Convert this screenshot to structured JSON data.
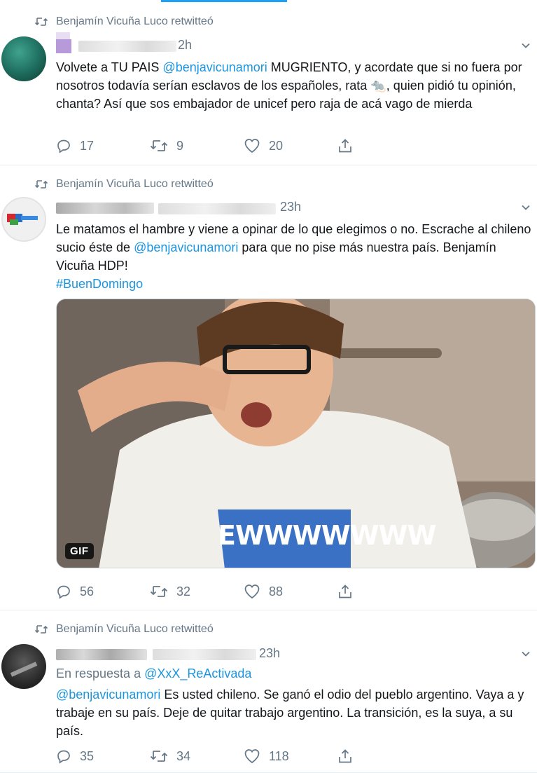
{
  "tweets": [
    {
      "retweeted_by": "Benjamín Vicuña Luco retwitteó",
      "time": "2h",
      "text_parts": {
        "a": "Volvete a TU PAIS ",
        "mention": "@benjavicunamori",
        "b": " MUGRIENTO, y acordate que si no fuera por nosotros todavía serían esclavos de los españoles, rata ",
        "emoji": "🐀",
        "c": ", quien pidió tu opinión, chanta? Así que sos embajador de unicef pero raja de acá vago de mierda"
      },
      "replies": "17",
      "retweets": "9",
      "likes": "20"
    },
    {
      "retweeted_by": "Benjamín Vicuña Luco retwitteó",
      "time": "23h",
      "text_parts": {
        "a": "Le matamos el hambre y viene a opinar de lo que elegimos o no. Escrache al chileno sucio éste de ",
        "mention": "@benjavicunamori",
        "b": " para que no pise más nuestra país. Benjamín Vicuña HDP!",
        "hashtag": "#BuenDomingo"
      },
      "media": {
        "badge": "GIF",
        "caption": "EWWWWWWW"
      },
      "replies": "56",
      "retweets": "32",
      "likes": "88"
    },
    {
      "retweeted_by": "Benjamín Vicuña Luco retwitteó",
      "time": "23h",
      "reply_prefix": "En respuesta a ",
      "reply_to": "@XxX_ReActivada",
      "text_parts": {
        "mention": "@benjavicunamori",
        "a": " Es usted chileno. Se ganó el odio del pueblo argentino. Vaya a y trabaje en su país. Deje de quitar trabajo argentino. La transición, es la suya, a su país."
      },
      "replies": "35",
      "retweets": "34",
      "likes": "118"
    }
  ],
  "colors": {
    "accent": "#1da1f2",
    "link": "#1b95e0",
    "muted": "#657786"
  },
  "icons": [
    "retweet-icon",
    "reply-icon",
    "like-icon",
    "share-icon",
    "chevron-down-icon"
  ]
}
